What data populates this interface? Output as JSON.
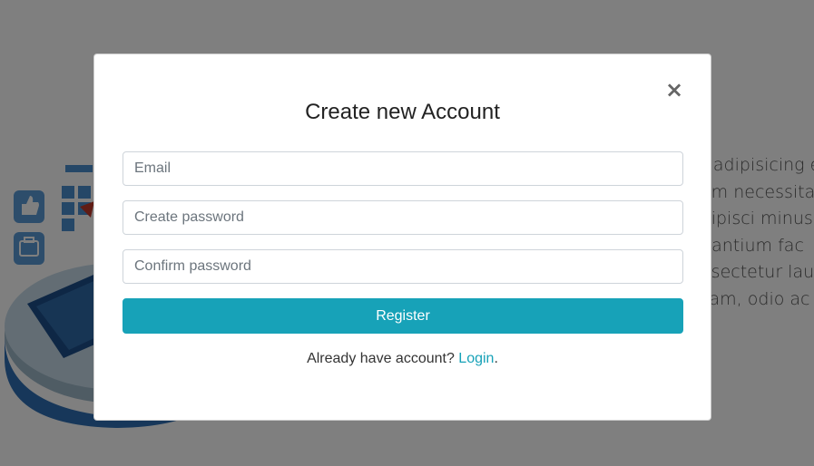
{
  "background": {
    "text_lines": [
      "ur adipisicing e",
      "uam necessita",
      "adipisci minus",
      "udantium fac",
      "onsectetur lau",
      "osam, odio ac"
    ]
  },
  "modal": {
    "title": "Create new Account",
    "close_glyph": "×",
    "email_placeholder": "Email",
    "password_placeholder": "Create password",
    "confirm_placeholder": "Confirm password",
    "register_label": "Register",
    "login_prompt": "Already have account? ",
    "login_link": "Login",
    "login_suffix": "."
  },
  "colors": {
    "accent": "#17a2b8",
    "overlay": "rgba(0,0,0,0.5)"
  },
  "icons": [
    "close-icon",
    "thumbs-up-icon",
    "briefcase-icon",
    "keyboard-icon"
  ]
}
